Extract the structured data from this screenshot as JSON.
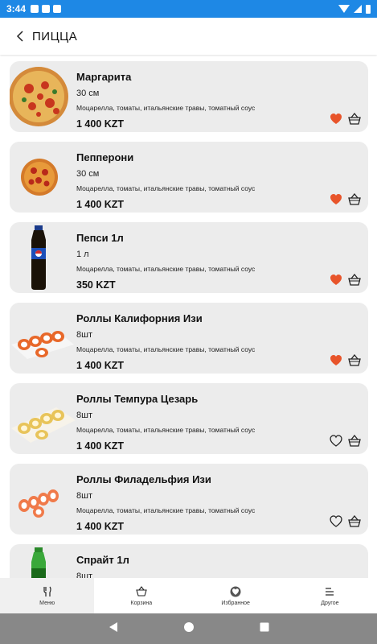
{
  "status_bar": {
    "time": "3:44"
  },
  "header": {
    "title": "ПИЦЦА"
  },
  "products": [
    {
      "name": "Маргарита",
      "size": "30 см",
      "description": "Моцарелла, томаты, итальянские травы, томатный соус",
      "price": "1 400 KZT",
      "favorite": true,
      "image": "pizza-margarita"
    },
    {
      "name": "Пепперони",
      "size": "30 см",
      "description": "Моцарелла, томаты, итальянские травы, томатный соус",
      "price": "1 400 KZT",
      "favorite": true,
      "image": "pizza-pepperoni"
    },
    {
      "name": "Пепси 1л",
      "size": "1 л",
      "description": "Моцарелла, томаты, итальянские травы, томатный соус",
      "price": "350 KZT",
      "favorite": true,
      "image": "pepsi-bottle"
    },
    {
      "name": "Роллы Калифорния Изи",
      "size": "8шт",
      "description": "Моцарелла, томаты, итальянские травы, томатный соус",
      "price": "1 400 KZT",
      "favorite": true,
      "image": "california-rolls"
    },
    {
      "name": "Роллы Темпура Цезарь",
      "size": "8шт",
      "description": "Моцарелла, томаты, итальянские травы, томатный соус",
      "price": "1 400 KZT",
      "favorite": false,
      "image": "tempura-rolls"
    },
    {
      "name": "Роллы Филадельфия Изи",
      "size": "8шт",
      "description": "Моцарелла, томаты, итальянские травы, томатный соус",
      "price": "1 400 KZT",
      "favorite": false,
      "image": "philadelphia-rolls"
    },
    {
      "name": "Спрайт 1л",
      "size": "8шт",
      "description": "",
      "price": "",
      "favorite": false,
      "image": "sprite-bottle"
    }
  ],
  "bottom_nav": [
    {
      "label": "Меню",
      "icon": "fork-knife-icon",
      "active": true
    },
    {
      "label": "Корзина",
      "icon": "basket-icon",
      "active": false
    },
    {
      "label": "Избранное",
      "icon": "heart-icon",
      "active": false
    },
    {
      "label": "Другое",
      "icon": "menu-lines-icon",
      "active": false
    }
  ],
  "colors": {
    "status_bar": "#1e88e5",
    "favorite_active": "#e8542a",
    "card_bg": "#ececec",
    "system_nav": "#888888"
  }
}
